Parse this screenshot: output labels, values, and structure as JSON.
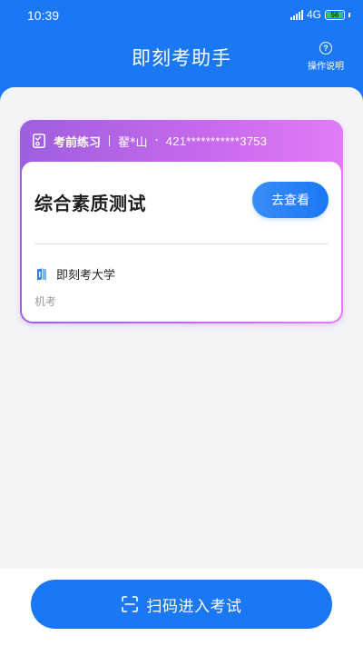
{
  "status_bar": {
    "time": "10:39",
    "network": "4G",
    "battery": "56"
  },
  "header": {
    "title": "即刻考助手",
    "help_label": "操作说明"
  },
  "exam_card": {
    "type": "考前练习",
    "user": "翟*山",
    "separator": "·",
    "id_number": "421***********3753",
    "title": "综合素质测试",
    "view_button": "去查看",
    "school": "即刻考大学",
    "mode": "机考"
  },
  "bottom": {
    "scan_button": "扫码进入考试"
  },
  "colors": {
    "primary": "#1a78f4",
    "card_gradient_start": "#9d5fdf",
    "card_gradient_end": "#e27bf6",
    "background": "#f3f4f6"
  }
}
